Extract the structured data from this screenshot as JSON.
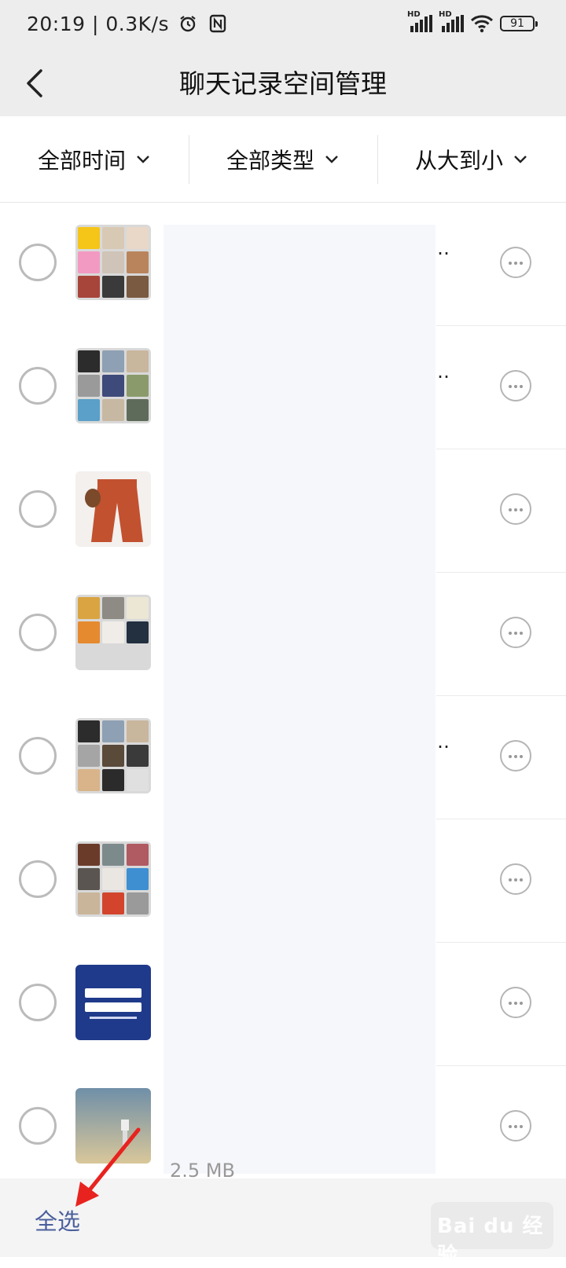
{
  "status_bar": {
    "time": "20:19",
    "network_speed": "0.3K/s",
    "sim1_label": "HD",
    "sim2_label": "HD",
    "battery": "91",
    "icons": [
      "alarm-icon",
      "nfc-icon",
      "signal-icon",
      "wifi-icon",
      "battery-icon"
    ]
  },
  "header": {
    "title": "聊天记录空间管理",
    "back_icon": "back-chevron-icon"
  },
  "filters": [
    {
      "label": "全部时间",
      "icon": "chevron-down-icon"
    },
    {
      "label": "全部类型",
      "icon": "chevron-down-icon"
    },
    {
      "label": "从大到小",
      "icon": "chevron-down-icon"
    }
  ],
  "list": {
    "truncation_marker": "…",
    "partial_size_text": "2.5 MB",
    "items": [
      {
        "thumb": "group-avatar-grid",
        "colors": [
          "#f5c518",
          "#d8c9b4",
          "#e9d8c8",
          "#f29ac2",
          "#cfc4b7",
          "#b9845c",
          "#a8453b",
          "#3a3a3a",
          "#7a5a40"
        ],
        "truncated": true
      },
      {
        "thumb": "group-avatar-grid",
        "colors": [
          "#2c2c2c",
          "#8ea0b3",
          "#c8b69d",
          "#9a9a9a",
          "#3e4a7a",
          "#8b9a6b",
          "#5aa0c8",
          "#c7b8a3",
          "#5f6b5a"
        ],
        "truncated": true
      },
      {
        "thumb": "product-pants-photo",
        "colors": [
          "#c2512f"
        ],
        "truncated": false
      },
      {
        "thumb": "group-avatar-grid",
        "colors": [
          "#d9a441",
          "#8e8a84",
          "#ece6d5",
          "#e58a2e",
          "#f0ede8",
          "#223040"
        ],
        "truncated": false
      },
      {
        "thumb": "group-avatar-grid",
        "colors": [
          "#2c2c2c",
          "#8ea0b3",
          "#c8b69d",
          "#a5a5a5",
          "#5a4a3a",
          "#3a3a3a",
          "#d9b48a",
          "#2b2b2b",
          "#e0e0e0"
        ],
        "truncated": true
      },
      {
        "thumb": "group-avatar-grid",
        "colors": [
          "#6b3b2a",
          "#7d8a8c",
          "#b05a62",
          "#5a5550",
          "#eae6e2",
          "#3d8fd1",
          "#c9b59a",
          "#d2452c",
          "#9a9a9a"
        ],
        "truncated": false
      },
      {
        "thumb": "text-poster",
        "colors": [
          "#1f3a8a"
        ],
        "truncated": false
      },
      {
        "thumb": "sky-robot-photo",
        "colors": [
          "#6f8fa8",
          "#d9c79a"
        ],
        "truncated": false
      }
    ]
  },
  "bottom_bar": {
    "select_all_label": "全选"
  },
  "watermark": {
    "text": "Bai du 经验"
  },
  "colors": {
    "header_bg": "#ededed",
    "select_all_text": "#4a5f9c",
    "arrow": "#e8231f"
  }
}
